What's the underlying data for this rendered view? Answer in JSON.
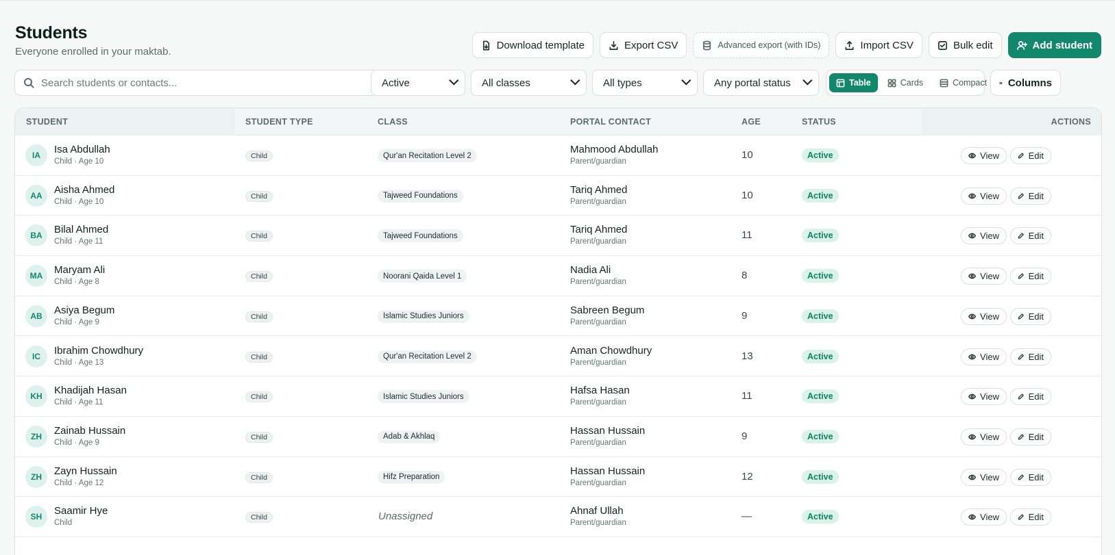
{
  "header": {
    "title": "Students",
    "subtitle": "Everyone enrolled in your maktab."
  },
  "toolbar": {
    "download_template": "Download template",
    "export_csv": "Export CSV",
    "advanced_export": "Advanced export (with IDs)",
    "import_csv": "Import CSV",
    "bulk_edit": "Bulk edit",
    "add_student": "Add student"
  },
  "filters": {
    "search_placeholder": "Search students or contacts...",
    "status": "Active",
    "class": "All classes",
    "type": "All types",
    "portal": "Any portal status"
  },
  "view_switch": {
    "table": "Table",
    "cards": "Cards",
    "compact": "Compact",
    "active": "table"
  },
  "columns_label": "Columns",
  "table": {
    "headers": {
      "student": "STUDENT",
      "type": "STUDENT TYPE",
      "class": "CLASS",
      "contact": "PORTAL CONTACT",
      "age": "AGE",
      "status": "STATUS",
      "actions": "ACTIONS"
    },
    "view_label": "View",
    "edit_label": "Edit",
    "rows": [
      {
        "initials": "IA",
        "name": "Isa Abdullah",
        "sub": "Child · Age 10",
        "type": "Child",
        "class": "Qur'an Recitation Level 2",
        "contact": "Mahmood Abdullah",
        "role": "Parent/guardian",
        "age": "10",
        "status": "Active"
      },
      {
        "initials": "AA",
        "name": "Aisha Ahmed",
        "sub": "Child · Age 10",
        "type": "Child",
        "class": "Tajweed Foundations",
        "contact": "Tariq Ahmed",
        "role": "Parent/guardian",
        "age": "10",
        "status": "Active"
      },
      {
        "initials": "BA",
        "name": "Bilal Ahmed",
        "sub": "Child · Age 11",
        "type": "Child",
        "class": "Tajweed Foundations",
        "contact": "Tariq Ahmed",
        "role": "Parent/guardian",
        "age": "11",
        "status": "Active"
      },
      {
        "initials": "MA",
        "name": "Maryam Ali",
        "sub": "Child · Age 8",
        "type": "Child",
        "class": "Noorani Qaida Level 1",
        "contact": "Nadia Ali",
        "role": "Parent/guardian",
        "age": "8",
        "status": "Active"
      },
      {
        "initials": "AB",
        "name": "Asiya Begum",
        "sub": "Child · Age 9",
        "type": "Child",
        "class": "Islamic Studies Juniors",
        "contact": "Sabreen Begum",
        "role": "Parent/guardian",
        "age": "9",
        "status": "Active"
      },
      {
        "initials": "IC",
        "name": "Ibrahim Chowdhury",
        "sub": "Child · Age 13",
        "type": "Child",
        "class": "Qur'an Recitation Level 2",
        "contact": "Aman Chowdhury",
        "role": "Parent/guardian",
        "age": "13",
        "status": "Active"
      },
      {
        "initials": "KH",
        "name": "Khadijah Hasan",
        "sub": "Child · Age 11",
        "type": "Child",
        "class": "Islamic Studies Juniors",
        "contact": "Hafsa Hasan",
        "role": "Parent/guardian",
        "age": "11",
        "status": "Active"
      },
      {
        "initials": "ZH",
        "name": "Zainab Hussain",
        "sub": "Child · Age 9",
        "type": "Child",
        "class": "Adab & Akhlaq",
        "contact": "Hassan Hussain",
        "role": "Parent/guardian",
        "age": "9",
        "status": "Active"
      },
      {
        "initials": "ZH",
        "name": "Zayn Hussain",
        "sub": "Child · Age 12",
        "type": "Child",
        "class": "Hifz Preparation",
        "contact": "Hassan Hussain",
        "role": "Parent/guardian",
        "age": "12",
        "status": "Active"
      },
      {
        "initials": "SH",
        "name": "Saamir Hye",
        "sub": "Child",
        "type": "Child",
        "class": "Unassigned",
        "unassigned": true,
        "contact": "Ahnaf Ullah",
        "role": "Parent/guardian",
        "age": "—",
        "status": "Active"
      }
    ]
  },
  "colors": {
    "accent": "#12876c",
    "status_bg": "#d9f3e8",
    "avatar_bg": "#dff1ec"
  }
}
